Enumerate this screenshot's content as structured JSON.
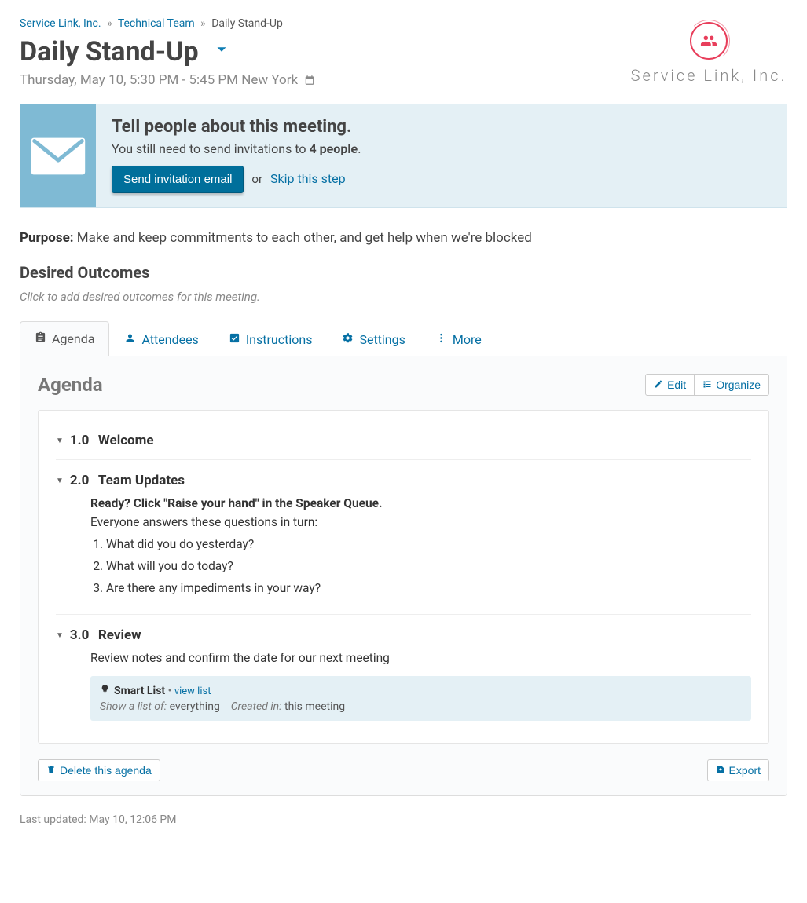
{
  "breadcrumb": {
    "org": "Service Link, Inc.",
    "team": "Technical Team",
    "current": "Daily Stand-Up"
  },
  "page_title": "Daily Stand-Up",
  "subtitle": "Thursday, May 10, 5:30 PM - 5:45 PM New York",
  "logo_text": "Service Link, Inc.",
  "banner": {
    "title": "Tell people about this meeting.",
    "text_pre": "You still need to send invitations to ",
    "text_bold": "4 people",
    "text_post": ".",
    "button": "Send invitation email",
    "or": "or",
    "skip": "Skip this step"
  },
  "purpose_label": "Purpose:",
  "purpose_text": "Make and keep commitments to each other, and get help when we're blocked",
  "outcomes_heading": "Desired Outcomes",
  "outcomes_placeholder": "Click to add desired outcomes for this meeting.",
  "tabs": {
    "agenda": "Agenda",
    "attendees": "Attendees",
    "instructions": "Instructions",
    "settings": "Settings",
    "more": "More"
  },
  "pane": {
    "title": "Agenda",
    "edit": "Edit",
    "organize": "Organize"
  },
  "agenda": [
    {
      "num": "1.0",
      "title": "Welcome"
    },
    {
      "num": "2.0",
      "title": "Team Updates",
      "ready_line": "Ready? Click \"Raise your hand\" in the Speaker Queue.",
      "intro": "Everyone answers these questions in turn:",
      "questions": [
        "What did you do yesterday?",
        "What will you do today?",
        "Are there any impediments in your way?"
      ]
    },
    {
      "num": "3.0",
      "title": "Review",
      "text": "Review notes and confirm the date for our next meeting",
      "smartlist": {
        "label": "Smart List",
        "view": "view list",
        "show_label": "Show a list of:",
        "show_value": "everything",
        "created_label": "Created in:",
        "created_value": "this meeting"
      }
    }
  ],
  "delete_agenda": "Delete this agenda",
  "export": "Export",
  "last_updated": "Last updated: May 10, 12:06 PM"
}
